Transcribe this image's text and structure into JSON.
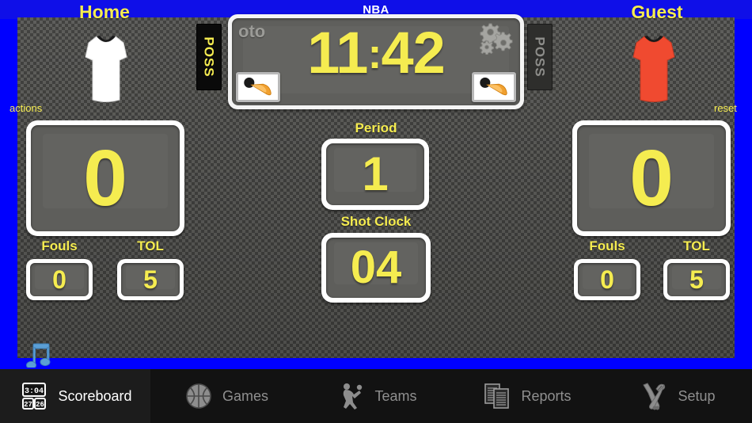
{
  "titlebar": {
    "title": "NBA"
  },
  "colors": {
    "background_blue": "#0000FF",
    "digit_yellow": "#F5EC50",
    "panel_gray": "#565653",
    "bezel_white": "#FFFFFF",
    "tabbar_black": "#121212",
    "home_jersey": "#FFFFFF",
    "guest_jersey": "#F04A30"
  },
  "home": {
    "name": "Home",
    "jersey_icon": "white-jersey-icon",
    "poss_label": "POSS",
    "poss_active": true,
    "score": "0",
    "fouls_caption": "Fouls",
    "fouls": "0",
    "tol_caption": "TOL",
    "tol": "5",
    "actions_link": "actions"
  },
  "guest": {
    "name": "Guest",
    "jersey_icon": "red-jersey-icon",
    "poss_label": "POSS",
    "poss_active": false,
    "score": "0",
    "fouls_caption": "Fouls",
    "fouls": "0",
    "tol_caption": "TOL",
    "tol": "5",
    "reset_link": "reset"
  },
  "clock": {
    "auto_label": "oto",
    "minutes": "11",
    "colon": ":",
    "seconds": "42",
    "settings_icon": "gears-icon",
    "horn_left_icon": "air-horn-icon",
    "horn_right_icon": "air-horn-icon"
  },
  "center": {
    "period_caption": "Period",
    "period": "1",
    "shot_clock_caption": "Shot Clock",
    "shot_clock": "04"
  },
  "extras": {
    "music_icon": "music-note-icon"
  },
  "tabbar": {
    "tabs": [
      {
        "label": "Scoreboard",
        "icon": "mini-scoreboard-icon",
        "active": true,
        "icon_time": "3:04",
        "icon_home_score": "27",
        "icon_guest_score": "26"
      },
      {
        "label": "Games",
        "icon": "basketball-icon",
        "active": false
      },
      {
        "label": "Teams",
        "icon": "player-icon",
        "active": false
      },
      {
        "label": "Reports",
        "icon": "documents-icon",
        "active": false
      },
      {
        "label": "Setup",
        "icon": "tools-icon",
        "active": false
      }
    ]
  }
}
